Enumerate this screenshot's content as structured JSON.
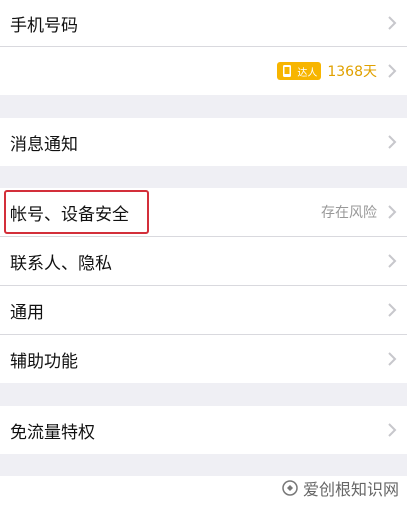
{
  "items": [
    {
      "label": "手机号码"
    },
    {
      "badge": "达人",
      "days": "1368天"
    },
    {
      "label": "消息通知"
    },
    {
      "label": "帐号、设备安全",
      "value": "存在风险"
    },
    {
      "label": "联系人、隐私"
    },
    {
      "label": "通用"
    },
    {
      "label": "辅助功能"
    },
    {
      "label": "免流量特权"
    }
  ],
  "watermark": "爱创根知识网",
  "colors": {
    "background": "#efeff4",
    "highlight": "#d32f3a",
    "badge": "#f7b500"
  }
}
